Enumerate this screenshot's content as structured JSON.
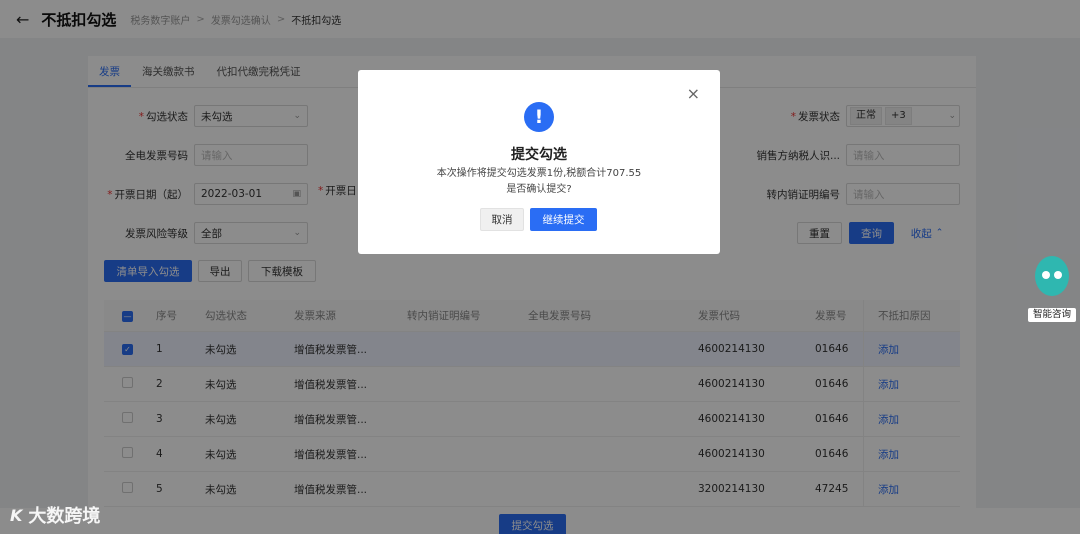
{
  "header": {
    "title": "不抵扣勾选",
    "breadcrumb": [
      "税务数字账户",
      "发票勾选确认",
      "不抵扣勾选"
    ]
  },
  "tabs": [
    "发票",
    "海关缴款书",
    "代扣代缴完税凭证"
  ],
  "filters": {
    "select_status": {
      "label": "勾选状态",
      "value": "未勾选"
    },
    "invoice_status": {
      "label": "发票状态",
      "tags": [
        "正常",
        "+3"
      ]
    },
    "einvoice_no": {
      "label": "全电发票号码",
      "placeholder": "请输入"
    },
    "seller_tax_id": {
      "label": "销售方纳税人识...",
      "placeholder": "请输入"
    },
    "date_start": {
      "label": "开票日期（起）",
      "value": "2022-03-01"
    },
    "date_end": {
      "label": "开票日"
    },
    "transfer_no": {
      "label": "转内销证明编号",
      "placeholder": "请输入"
    },
    "risk_level": {
      "label": "发票风险等级",
      "value": "全部"
    }
  },
  "actions": {
    "reset": "重置",
    "query": "查询",
    "collapse": "收起",
    "import": "清单导入勾选",
    "export": "导出",
    "template": "下载模板",
    "submit": "提交勾选"
  },
  "table": {
    "columns": [
      "序号",
      "勾选状态",
      "发票来源",
      "转内销证明编号",
      "全电发票号码",
      "发票代码",
      "发票号",
      "不抵扣原因"
    ],
    "rows": [
      {
        "no": "1",
        "status": "未勾选",
        "source": "增值税发票管...",
        "transfer": "",
        "einvoice": "",
        "code": "4600214130",
        "number": "01646",
        "reason": "添加",
        "checked": true
      },
      {
        "no": "2",
        "status": "未勾选",
        "source": "增值税发票管...",
        "transfer": "",
        "einvoice": "",
        "code": "4600214130",
        "number": "01646",
        "reason": "添加",
        "checked": false
      },
      {
        "no": "3",
        "status": "未勾选",
        "source": "增值税发票管...",
        "transfer": "",
        "einvoice": "",
        "code": "4600214130",
        "number": "01646",
        "reason": "添加",
        "checked": false
      },
      {
        "no": "4",
        "status": "未勾选",
        "source": "增值税发票管...",
        "transfer": "",
        "einvoice": "",
        "code": "4600214130",
        "number": "01646",
        "reason": "添加",
        "checked": false
      },
      {
        "no": "5",
        "status": "未勾选",
        "source": "增值税发票管...",
        "transfer": "",
        "einvoice": "",
        "code": "3200214130",
        "number": "47245",
        "reason": "添加",
        "checked": false
      }
    ]
  },
  "assistant": {
    "label": "智能咨询"
  },
  "watermark": {
    "logo": "K",
    "text": "大数跨境"
  },
  "modal": {
    "icon": "!",
    "close": "×",
    "title": "提交勾选",
    "line1": "本次操作将提交勾选发票1份,税额合计707.55",
    "line2": "是否确认提交?",
    "cancel": "取消",
    "confirm": "继续提交"
  },
  "colors": {
    "primary": "#2a6df4",
    "required": "#e33333",
    "overlay": "rgba(0,0,0,0.45)"
  }
}
